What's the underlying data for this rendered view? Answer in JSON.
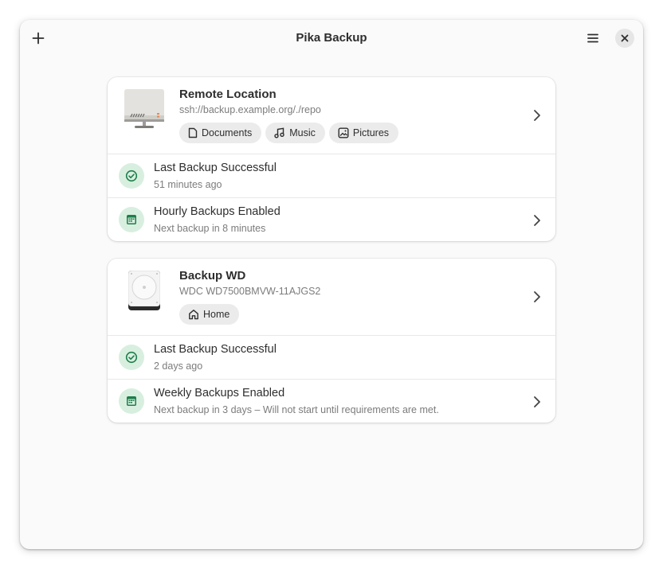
{
  "window": {
    "title": "Pika Backup"
  },
  "headerbar": {
    "add_icon": "plus-icon",
    "menu_icon": "hamburger-menu-icon",
    "close_icon": "close-icon"
  },
  "colors": {
    "success_green": "#1e7e4a",
    "success_bg": "#d8efe0",
    "tag_bg": "#ebebeb",
    "card_bg": "#ffffff",
    "window_bg": "#fafafa"
  },
  "repos": [
    {
      "title": "Remote Location",
      "subtitle": "ssh://backup.example.org/./repo",
      "device_icon": "network-server-icon",
      "tags": [
        {
          "label": "Documents",
          "icon": "document-icon"
        },
        {
          "label": "Music",
          "icon": "music-note-icon"
        },
        {
          "label": "Pictures",
          "icon": "image-icon"
        }
      ],
      "status": {
        "title": "Last Backup Successful",
        "subtitle": "51 minutes ago",
        "icon": "check-circle-icon"
      },
      "schedule": {
        "title": "Hourly Backups Enabled",
        "subtitle": "Next backup in 8 minutes",
        "icon": "calendar-icon"
      }
    },
    {
      "title": "Backup WD",
      "subtitle": "WDC WD7500BMVW-11AJGS2",
      "device_icon": "hard-drive-icon",
      "tags": [
        {
          "label": "Home",
          "icon": "home-icon"
        }
      ],
      "status": {
        "title": "Last Backup Successful",
        "subtitle": "2 days ago",
        "icon": "check-circle-icon"
      },
      "schedule": {
        "title": "Weekly Backups Enabled",
        "subtitle": "Next backup in 3 days – Will not start until requirements are met.",
        "icon": "calendar-icon"
      }
    }
  ]
}
